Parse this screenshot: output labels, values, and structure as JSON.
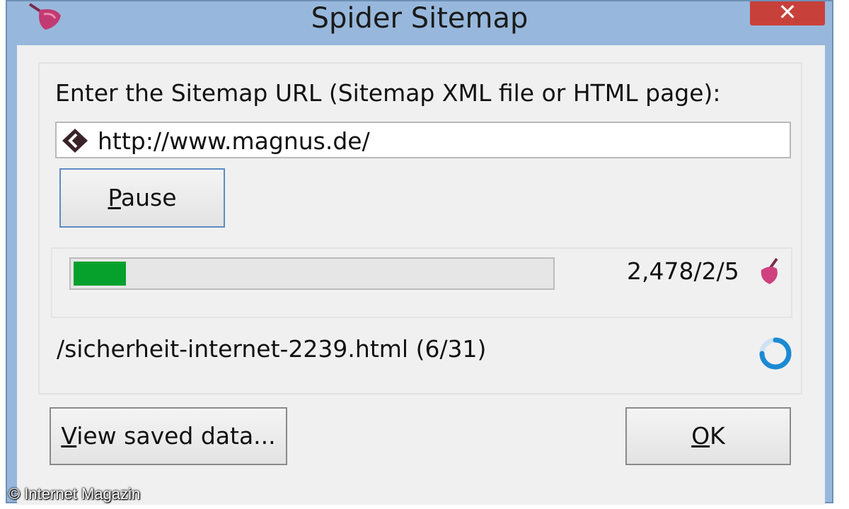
{
  "window": {
    "title": "Spider Sitemap",
    "close_glyph": "✕",
    "app_icon": "spider-broom-icon"
  },
  "form": {
    "prompt_label": "Enter the Sitemap URL (Sitemap XML file or HTML page):",
    "url_value": "http://www.magnus.de/",
    "url_icon": "url-arrow-icon"
  },
  "buttons": {
    "pause_first": "P",
    "pause_rest": "ause",
    "view_first": "V",
    "view_rest": "iew saved data...",
    "ok_first": "O",
    "ok_rest": "K"
  },
  "progress": {
    "fraction": 0.12,
    "counts": "2,478/2/5",
    "fill_color": "#06a12d",
    "counts_icon": "broom-icon"
  },
  "status": {
    "current_file": "/sicherheit-internet-2239.html (6/31)",
    "spinner_icon": "loading-spinner-icon"
  },
  "watermark": "© Internet Magazin"
}
